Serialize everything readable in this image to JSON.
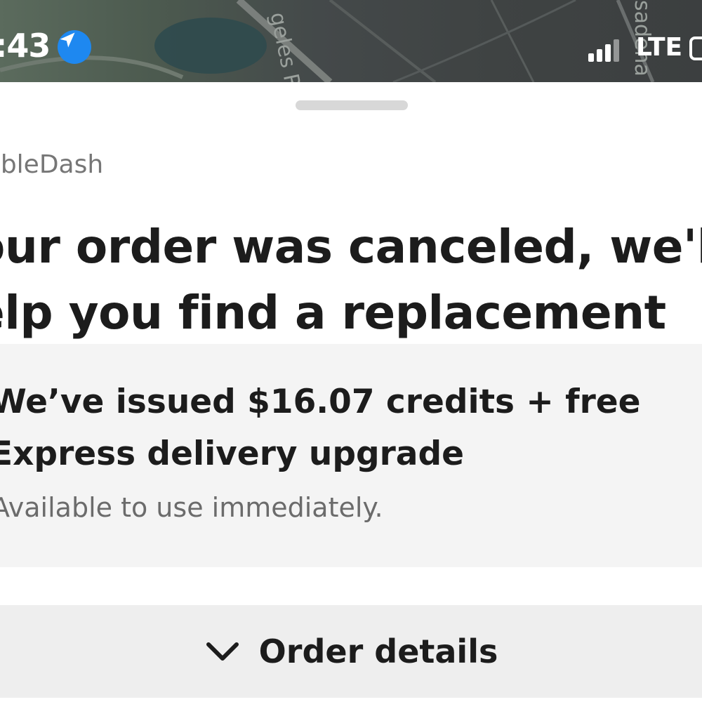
{
  "status_bar": {
    "time": ":43",
    "network": "LTE",
    "icons": [
      "location-arrow-icon",
      "signal-bars-icon",
      "battery-icon"
    ],
    "accent_color": "#1e88f0"
  },
  "map": {
    "labels": [
      "geles Ri",
      "sadena"
    ]
  },
  "sheet": {
    "store_name": "ubleDash",
    "headline_lines": [
      "our order was canceled, we'l",
      "elp you find a replacement"
    ],
    "credit": {
      "title_lines": [
        "We’ve issued $16.07 credits + free",
        "Express delivery upgrade"
      ],
      "subtitle": "Available to use immediately."
    },
    "order_details": {
      "label": "Order details",
      "icon": "chevron-down-icon"
    }
  }
}
